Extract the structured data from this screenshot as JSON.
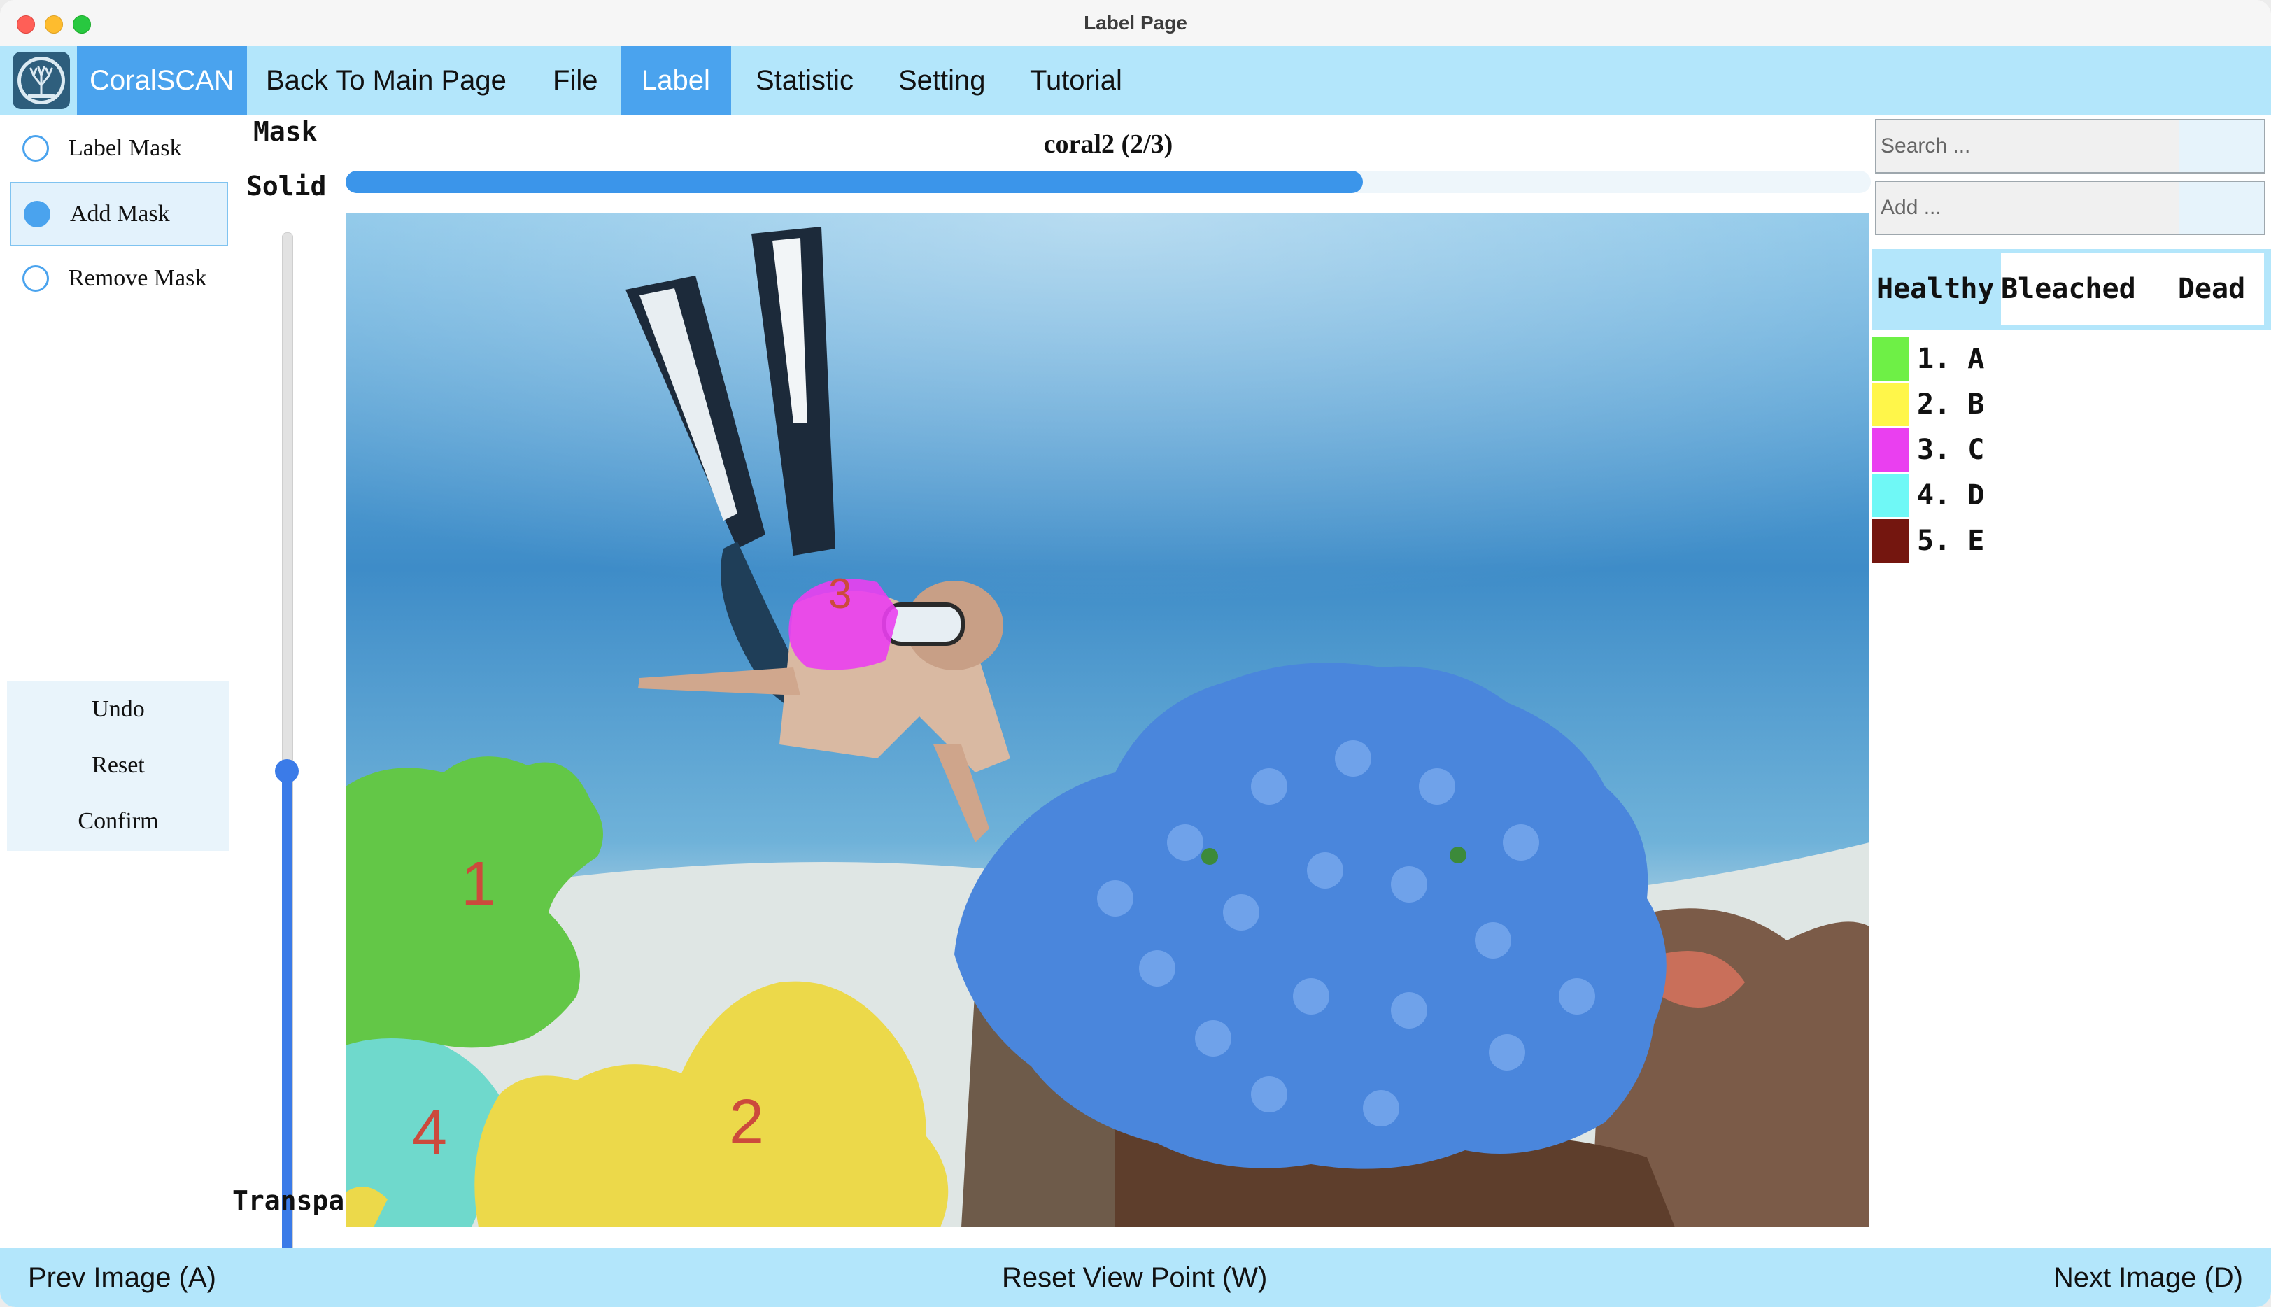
{
  "window": {
    "title": "Label Page"
  },
  "menu": {
    "brand": "CoralSCAN",
    "items": [
      "Back To Main Page",
      "File",
      "Label",
      "Statistic",
      "Setting",
      "Tutorial"
    ],
    "active": "Label"
  },
  "tools": {
    "modes": [
      "Label Mask",
      "Add Mask",
      "Remove Mask"
    ],
    "selected_mode": "Add Mask",
    "actions": [
      "Undo",
      "Reset",
      "Confirm"
    ]
  },
  "mask_slider": {
    "title": "Mask",
    "top_label": "Solid",
    "bottom_label": "Transpa",
    "value_fraction_from_bottom": 0.5
  },
  "image": {
    "title": "coral2 (2/3)",
    "progress_fraction": 0.667
  },
  "labels": {
    "search_placeholder": "Search ...",
    "add_placeholder": "Add ...",
    "tabs": [
      "Healthy",
      "Bleached",
      "Dead"
    ],
    "active_tab": "Healthy",
    "items": [
      {
        "text": "1. A",
        "color": "#6ef046"
      },
      {
        "text": "2. B",
        "color": "#fff64a"
      },
      {
        "text": "3. C",
        "color": "#ea3ff0"
      },
      {
        "text": "4. D",
        "color": "#6ff8f6"
      },
      {
        "text": "5. E",
        "color": "#74160f"
      }
    ]
  },
  "canvas_markers": [
    "1",
    "2",
    "3",
    "4"
  ],
  "footer": {
    "prev": "Prev Image (A)",
    "reset_view": "Reset View Point (W)",
    "next": "Next Image (D)"
  },
  "colors": {
    "accent": "#4aa3ee",
    "bar": "#b3e6fb",
    "slider": "#3b7be8"
  }
}
